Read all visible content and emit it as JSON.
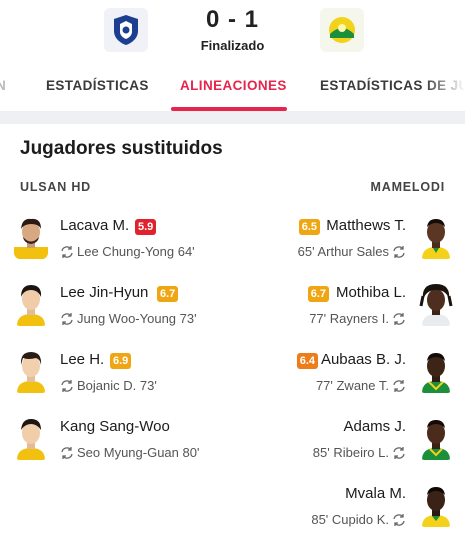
{
  "match": {
    "score": "0 - 1",
    "status": "Finalizado",
    "home_crest_icon": "ulsan-hd-crest-icon",
    "away_crest_icon": "mamelodi-crest-icon"
  },
  "tabs": [
    {
      "label": "N"
    },
    {
      "label": "ESTADÍSTICAS"
    },
    {
      "label": "ALINEACIONES",
      "active": true
    },
    {
      "label": "ESTADÍSTICAS DE JU"
    }
  ],
  "section": {
    "title": "Jugadores sustituidos",
    "home_team": "ULSAN HD",
    "away_team": "MAMELODI"
  },
  "colors": {
    "accent": "#e5254c",
    "rating_red": "#e0222f",
    "rating_yellow": "#f0a512",
    "rating_orange": "#ed7d1a"
  },
  "home_subs": [
    {
      "name": "Lacava M.",
      "rating": "5.9",
      "sub_text": "Lee Chung-Yong 64'"
    },
    {
      "name": "Lee Jin-Hyun",
      "rating": "6.7",
      "sub_text": "Jung Woo-Young 73'"
    },
    {
      "name": "Lee H.",
      "rating": "6.9",
      "sub_text": "Bojanic D. 73'"
    },
    {
      "name": "Kang Sang-Woo",
      "rating": "",
      "sub_text": "Seo Myung-Guan 80'"
    }
  ],
  "away_subs": [
    {
      "name": "Matthews T.",
      "rating": "6.5",
      "sub_text": "65' Arthur Sales"
    },
    {
      "name": "Mothiba L.",
      "rating": "6.7",
      "sub_text": "77' Rayners I."
    },
    {
      "name": "Aubaas B. J.",
      "rating": "6.4",
      "sub_text": "77' Zwane T."
    },
    {
      "name": "Adams J.",
      "rating": "",
      "sub_text": "85' Ribeiro L."
    },
    {
      "name": "Mvala M.",
      "rating": "",
      "sub_text": "85' Cupido K."
    }
  ]
}
